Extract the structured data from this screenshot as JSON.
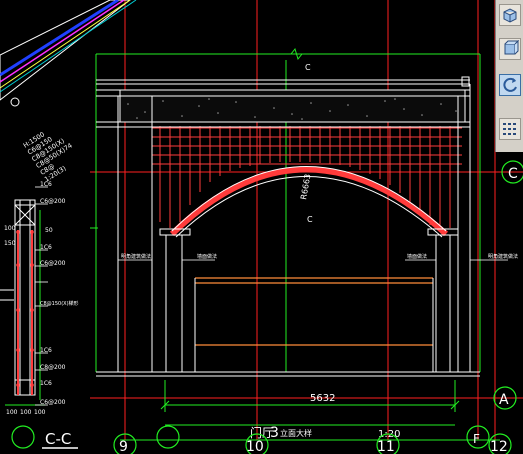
{
  "drawing": {
    "title_prefix": "门厅",
    "title_number": "3",
    "title_suffix": "立面大样",
    "scale": "1:20",
    "dimension_width": "5632",
    "radius_label": "R6663",
    "break_label_top": "C",
    "break_label_mid": "C",
    "section_label": "C-C",
    "callouts_left": [
      "明角建筑做法",
      "墙面做法"
    ],
    "callouts_right": [
      "墙面做法",
      "明角建筑做法"
    ]
  },
  "section": {
    "rebar_labels": [
      "1C6",
      "C6@200",
      "1C6",
      "C6@200",
      "C8@150(X)梯形",
      "1C6",
      "C8@200",
      "1C6",
      "C6@200"
    ],
    "side_dims": [
      "100",
      "50",
      "150"
    ],
    "bottom_dims": [
      "100",
      "100",
      "100"
    ]
  },
  "grid": {
    "axes_bottom": [
      "9",
      "10",
      "11",
      "12"
    ],
    "axis_F": "F",
    "axes_right": [
      "C",
      "A"
    ]
  },
  "inset": {
    "lines": [
      "H:1500",
      "C6@150",
      "C8@150(X)",
      "C8@50(X)74",
      "C8@",
      "1:20(3)"
    ]
  },
  "toolbar": {
    "tools": [
      "box-icon",
      "cylinder-icon",
      "rotate-icon",
      "grid-icon"
    ]
  },
  "colors": {
    "background": "#000000",
    "outline": "#ffffff",
    "axis": "#ff2020",
    "dimension": "#22ee22",
    "hatch": "#ff3b3b",
    "brick": "#ff8c3a",
    "accent_blue": "#2040ff",
    "accent_magenta": "#ff30ff",
    "accent_cyan": "#00c8d0"
  }
}
